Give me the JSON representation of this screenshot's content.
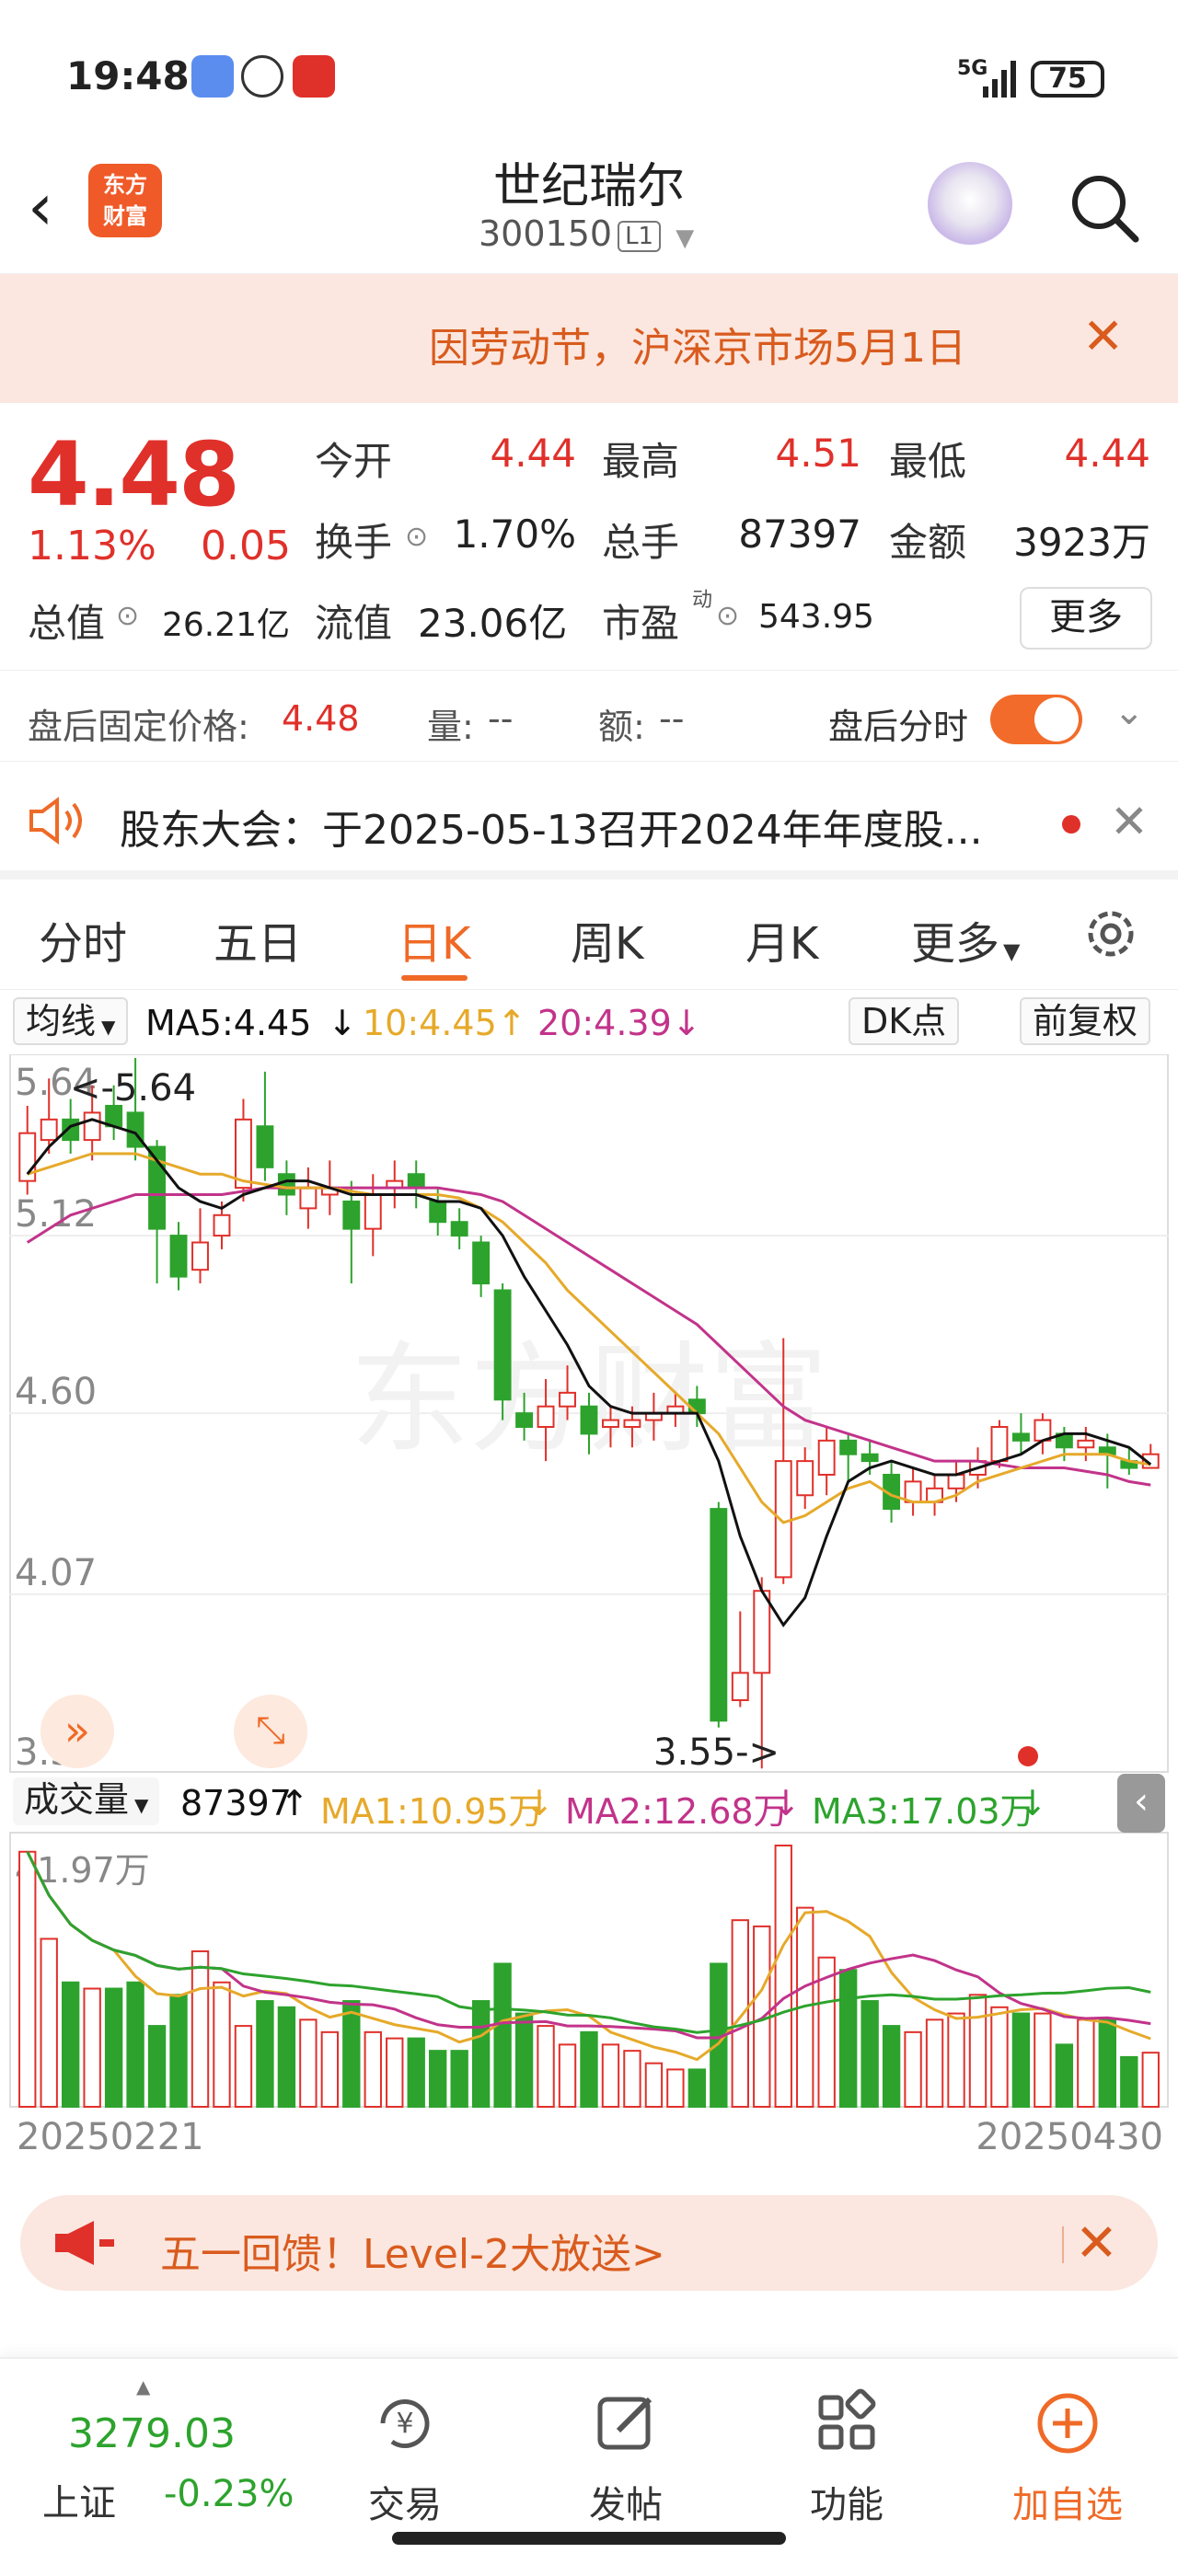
{
  "status_bar": {
    "time": "19:48",
    "network": "5G",
    "battery": "75"
  },
  "header": {
    "stock_name": "世纪瑞尔",
    "stock_code": "300150",
    "level_badge": "L1",
    "brand_logo_line1": "东方",
    "brand_logo_line2": "财富"
  },
  "notice": {
    "text": "因劳动节，沪深京市场5月1日"
  },
  "quote": {
    "price": "4.48",
    "change_pct": "1.13%",
    "change": "0.05",
    "open_label": "今开",
    "open": "4.44",
    "high_label": "最高",
    "high": "4.51",
    "low_label": "最低",
    "low": "4.44",
    "turnover_label": "换手",
    "turnover": "1.70%",
    "volume_label": "总手",
    "volume": "87397",
    "amount_label": "金额",
    "amount": "3923万",
    "mcap_label": "总值",
    "mcap": "26.21亿",
    "float_label": "流值",
    "float": "23.06亿",
    "pe_label": "市盈",
    "pe_sup": "动",
    "pe": "543.95",
    "more": "更多"
  },
  "after_hours": {
    "price_label": "盘后固定价格:",
    "price": "4.48",
    "vol_label": "量:",
    "vol": "--",
    "amt_label": "额:",
    "amt": "--",
    "toggle_label": "盘后分时"
  },
  "meeting": {
    "text": "股东大会：于2025-05-13召开2024年年度股..."
  },
  "tabs": [
    "分时",
    "五日",
    "日K",
    "周K",
    "月K",
    "更多"
  ],
  "ma_bar": {
    "select": "均线",
    "ma5": "MA5:4.45",
    "ma10": "10:4.45",
    "ma20": "20:4.39",
    "dk": "DK点",
    "adjust": "前复权"
  },
  "colors": {
    "up": "#e0302a",
    "down": "#2da32d",
    "ma5": "#111111",
    "ma10": "#e6a92a",
    "ma20": "#c2338a",
    "accent": "#ef6a27"
  },
  "vol_bar": {
    "select": "成交量",
    "vol": "87397",
    "ma1": "MA1:10.95万",
    "ma2": "MA2:12.68万",
    "ma3": "MA3:17.03万"
  },
  "chart_data": {
    "type": "candlestick",
    "y_ticks": [
      "5.64",
      "5.12",
      "4.60",
      "4.07",
      "3.55"
    ],
    "ylim": [
      3.55,
      5.64
    ],
    "max_label": "<-5.64",
    "min_label": "3.55->",
    "start_date": "20250221",
    "end_date": "20250430",
    "volume_max_label": "41.97万",
    "candles": [
      [
        5.28,
        5.42,
        5.5,
        5.24
      ],
      [
        5.4,
        5.46,
        5.58,
        5.36
      ],
      [
        5.46,
        5.4,
        5.52,
        5.36
      ],
      [
        5.4,
        5.48,
        5.56,
        5.34
      ],
      [
        5.5,
        5.44,
        5.56,
        5.4
      ],
      [
        5.48,
        5.38,
        5.64,
        5.34
      ],
      [
        5.38,
        5.14,
        5.4,
        4.98
      ],
      [
        5.12,
        5.0,
        5.16,
        4.96
      ],
      [
        5.02,
        5.1,
        5.2,
        4.98
      ],
      [
        5.12,
        5.18,
        5.22,
        5.08
      ],
      [
        5.26,
        5.46,
        5.52,
        5.22
      ],
      [
        5.44,
        5.32,
        5.6,
        5.28
      ],
      [
        5.3,
        5.24,
        5.34,
        5.18
      ],
      [
        5.2,
        5.26,
        5.32,
        5.14
      ],
      [
        5.24,
        5.26,
        5.34,
        5.18
      ],
      [
        5.22,
        5.14,
        5.28,
        4.98
      ],
      [
        5.14,
        5.24,
        5.3,
        5.06
      ],
      [
        5.26,
        5.28,
        5.34,
        5.2
      ],
      [
        5.3,
        5.26,
        5.34,
        5.2
      ],
      [
        5.22,
        5.16,
        5.26,
        5.12
      ],
      [
        5.16,
        5.12,
        5.2,
        5.08
      ],
      [
        5.1,
        4.98,
        5.12,
        4.94
      ],
      [
        4.96,
        4.64,
        4.98,
        4.58
      ],
      [
        4.6,
        4.56,
        4.66,
        4.52
      ],
      [
        4.56,
        4.62,
        4.7,
        4.46
      ],
      [
        4.62,
        4.66,
        4.74,
        4.58
      ],
      [
        4.62,
        4.54,
        4.66,
        4.48
      ],
      [
        4.56,
        4.58,
        4.62,
        4.5
      ],
      [
        4.56,
        4.58,
        4.62,
        4.5
      ],
      [
        4.58,
        4.6,
        4.66,
        4.52
      ],
      [
        4.6,
        4.62,
        4.66,
        4.56
      ],
      [
        4.64,
        4.6,
        4.68,
        4.56
      ],
      [
        4.32,
        3.7,
        4.34,
        3.68
      ],
      [
        3.76,
        3.84,
        4.02,
        3.74
      ],
      [
        3.84,
        4.08,
        4.12,
        3.56
      ],
      [
        4.12,
        4.46,
        4.82,
        4.1
      ],
      [
        4.36,
        4.46,
        4.5,
        4.32
      ],
      [
        4.42,
        4.52,
        4.56,
        4.36
      ],
      [
        4.52,
        4.48,
        4.54,
        4.4
      ],
      [
        4.48,
        4.46,
        4.52,
        4.42
      ],
      [
        4.42,
        4.32,
        4.46,
        4.28
      ],
      [
        4.34,
        4.4,
        4.44,
        4.3
      ],
      [
        4.34,
        4.38,
        4.42,
        4.3
      ],
      [
        4.38,
        4.42,
        4.46,
        4.34
      ],
      [
        4.42,
        4.46,
        4.5,
        4.38
      ],
      [
        4.46,
        4.56,
        4.58,
        4.44
      ],
      [
        4.54,
        4.52,
        4.6,
        4.48
      ],
      [
        4.52,
        4.58,
        4.6,
        4.48
      ],
      [
        4.54,
        4.5,
        4.56,
        4.46
      ],
      [
        4.5,
        4.52,
        4.56,
        4.46
      ],
      [
        4.5,
        4.48,
        4.54,
        4.38
      ],
      [
        4.46,
        4.44,
        4.5,
        4.42
      ],
      [
        4.44,
        4.48,
        4.51,
        4.44
      ]
    ],
    "ma5": [
      5.3,
      5.38,
      5.44,
      5.46,
      5.44,
      5.42,
      5.34,
      5.26,
      5.22,
      5.2,
      5.24,
      5.26,
      5.28,
      5.28,
      5.26,
      5.24,
      5.24,
      5.24,
      5.24,
      5.22,
      5.22,
      5.2,
      5.12,
      5.0,
      4.9,
      4.8,
      4.68,
      4.62,
      4.6,
      4.6,
      4.6,
      4.6,
      4.46,
      4.24,
      4.08,
      3.98,
      4.06,
      4.24,
      4.4,
      4.44,
      4.46,
      4.44,
      4.42,
      4.42,
      4.44,
      4.46,
      4.48,
      4.52,
      4.54,
      4.54,
      4.52,
      4.5,
      4.45
    ],
    "ma10": [
      5.3,
      5.32,
      5.34,
      5.36,
      5.36,
      5.36,
      5.34,
      5.32,
      5.3,
      5.3,
      5.28,
      5.27,
      5.26,
      5.26,
      5.26,
      5.25,
      5.24,
      5.24,
      5.24,
      5.24,
      5.23,
      5.2,
      5.16,
      5.1,
      5.04,
      4.96,
      4.9,
      4.84,
      4.78,
      4.72,
      4.66,
      4.6,
      4.54,
      4.44,
      4.34,
      4.28,
      4.3,
      4.34,
      4.38,
      4.4,
      4.36,
      4.34,
      4.34,
      4.36,
      4.4,
      4.42,
      4.44,
      4.46,
      4.48,
      4.48,
      4.48,
      4.46,
      4.45
    ],
    "ma20": [
      5.1,
      5.14,
      5.18,
      5.2,
      5.22,
      5.24,
      5.24,
      5.24,
      5.24,
      5.24,
      5.25,
      5.26,
      5.26,
      5.26,
      5.26,
      5.26,
      5.26,
      5.26,
      5.26,
      5.26,
      5.25,
      5.24,
      5.22,
      5.18,
      5.14,
      5.1,
      5.06,
      5.02,
      4.98,
      4.94,
      4.9,
      4.86,
      4.8,
      4.74,
      4.68,
      4.62,
      4.58,
      4.56,
      4.54,
      4.52,
      4.5,
      4.48,
      4.46,
      4.46,
      4.46,
      4.45,
      4.44,
      4.44,
      4.44,
      4.43,
      4.42,
      4.4,
      4.39
    ],
    "volumes": [
      41,
      27,
      20,
      19,
      19,
      20,
      13,
      18,
      25,
      20,
      13,
      17,
      16,
      14,
      12,
      17,
      12,
      11,
      11,
      9,
      9,
      17,
      23,
      15,
      13,
      10,
      12,
      10,
      9,
      7,
      6,
      6,
      23,
      30,
      29,
      42,
      32,
      24,
      22,
      17,
      13,
      12,
      14,
      15,
      18,
      16,
      15,
      15,
      10,
      14,
      14,
      8,
      8.7
    ]
  }
}
